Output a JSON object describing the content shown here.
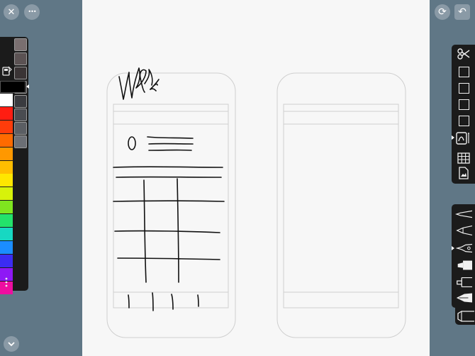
{
  "toolbar": {
    "close_glyph": "✕",
    "more_glyph": "•••",
    "refresh_glyph": "⟳",
    "undo_glyph": "↶",
    "collapse_glyph": "⌄"
  },
  "palette": {
    "tones": [
      "#7a6f70",
      "#5b5253",
      "#3a3435",
      "#262323",
      "#3a3b3f",
      "#4a4c51",
      "#5b5e63",
      "#6c6f75"
    ],
    "swatches": [
      "#ffffff",
      "#ff1d12",
      "#ff3c0b",
      "#ff6a00",
      "#ff9800",
      "#ffbd00",
      "#ffe600",
      "#d7f20a",
      "#7fe51f",
      "#23e26b",
      "#17d8c2",
      "#1b8dff",
      "#3c2cf2",
      "#8e18f5",
      "#ee0ea0"
    ],
    "selected_color": "#000000"
  },
  "tools": {
    "icons_top": [
      "scissors-icon",
      "frame-1-icon",
      "frame-2-icon",
      "frame-3-icon",
      "frame-4-icon",
      "pen-shape-icon",
      "table-icon",
      "image-doc-icon"
    ],
    "icons_bottom": [
      "fineliner-icon",
      "ballpoint-icon",
      "brush-pen-icon",
      "marker-icon",
      "highlighter-icon",
      "fountain-pen-icon",
      "eraser-icon"
    ]
  },
  "colors": {
    "background": "#607786",
    "canvas": "#f7f7f7",
    "panel": "#1b1b1b",
    "button": "#8a9aa6"
  }
}
